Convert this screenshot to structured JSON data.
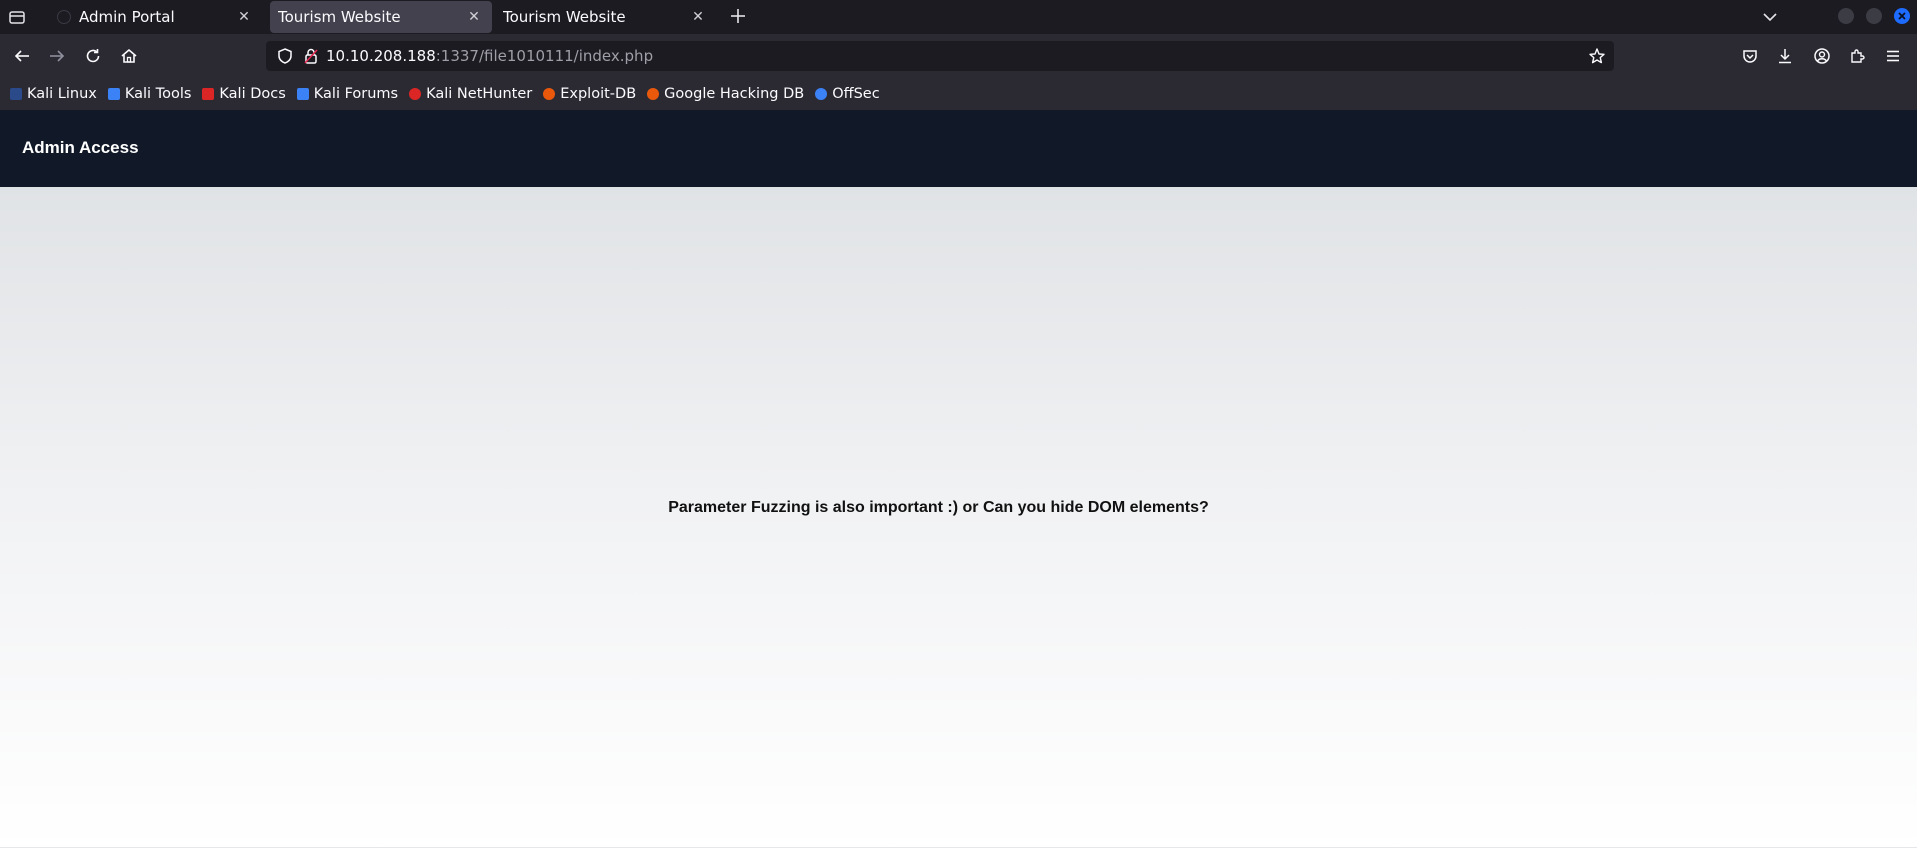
{
  "browser": {
    "tabs": [
      {
        "title": "Admin Portal",
        "selected": false
      },
      {
        "title": "Tourism Website",
        "selected": true
      },
      {
        "title": "Tourism Website",
        "selected": false
      }
    ],
    "url": {
      "host": "10.10.208.188",
      "rest": ":1337/file1010111/index.php"
    },
    "bookmarks": [
      {
        "label": "Kali Linux",
        "color": "#2a4a8a"
      },
      {
        "label": "Kali Tools",
        "color": "#3b82f6"
      },
      {
        "label": "Kali Docs",
        "color": "#dc2626"
      },
      {
        "label": "Kali Forums",
        "color": "#3b82f6"
      },
      {
        "label": "Kali NetHunter",
        "color": "#dc2626"
      },
      {
        "label": "Exploit-DB",
        "color": "#ea580c"
      },
      {
        "label": "Google Hacking DB",
        "color": "#ea580c"
      },
      {
        "label": "OffSec",
        "color": "#3b82f6"
      }
    ],
    "icons": {
      "tab_list": "tab-list-icon",
      "new_tab": "plus-icon",
      "back": "back-arrow-icon",
      "forward": "forward-arrow-icon",
      "reload": "reload-icon",
      "home": "home-icon",
      "tracking": "shield-icon",
      "connection": "lock-icon",
      "bookmark_star": "star-icon",
      "pocket": "pocket-icon",
      "downloads": "download-icon",
      "account": "account-icon",
      "extensions": "extensions-icon",
      "menu": "hamburger-menu-icon"
    }
  },
  "page": {
    "header_title": "Admin Access",
    "message": "Parameter Fuzzing is also important :) or Can you hide DOM elements?",
    "header_color": "#111827"
  }
}
